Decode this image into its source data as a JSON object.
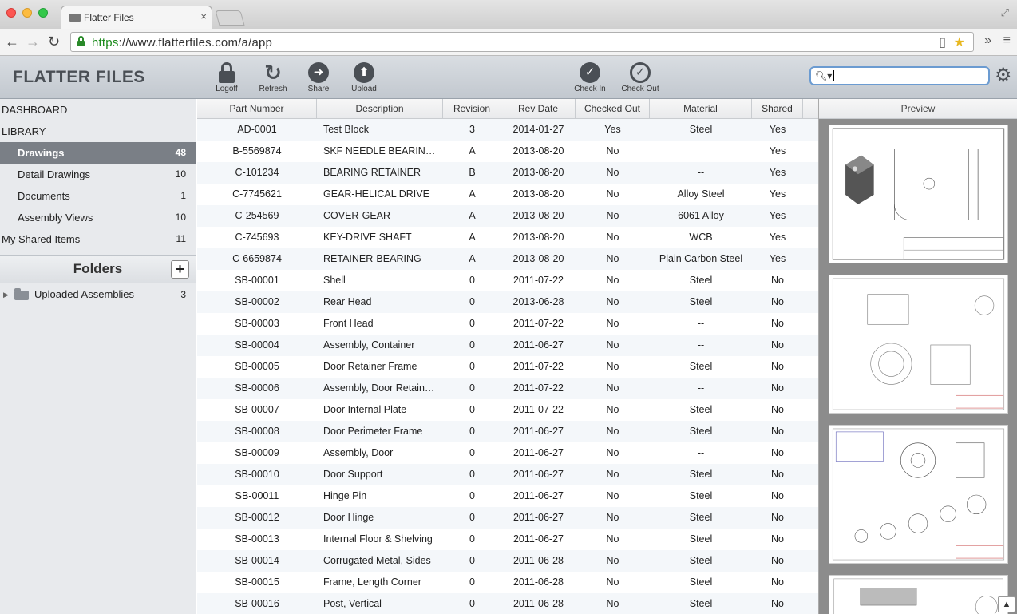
{
  "browser": {
    "tab_title": "Flatter Files",
    "tab_close": "×",
    "url_scheme": "https",
    "url_rest": "://www.flatterfiles.com/a/app"
  },
  "app": {
    "logo": "FLATTER FILES",
    "toolbar": {
      "logoff": "Logoff",
      "refresh": "Refresh",
      "share": "Share",
      "upload": "Upload",
      "checkin": "Check In",
      "checkout": "Check Out"
    },
    "search": {
      "value": "",
      "placeholder": ""
    }
  },
  "sidebar": {
    "dashboard": "DASHBOARD",
    "library": "LIBRARY",
    "items": [
      {
        "label": "Drawings",
        "count": "48"
      },
      {
        "label": "Detail Drawings",
        "count": "10"
      },
      {
        "label": "Documents",
        "count": "1"
      },
      {
        "label": "Assembly Views",
        "count": "10"
      }
    ],
    "shared": {
      "label": "My Shared Items",
      "count": "11"
    },
    "folders_title": "Folders",
    "folders_add": "+",
    "folders": [
      {
        "label": "Uploaded Assemblies",
        "count": "3"
      }
    ]
  },
  "table": {
    "columns": [
      "Part Number",
      "Description",
      "Revision",
      "Rev Date",
      "Checked Out",
      "Material",
      "Shared"
    ],
    "rows": [
      [
        "AD-0001",
        "Test Block",
        "3",
        "2014-01-27",
        "Yes",
        "Steel",
        "Yes"
      ],
      [
        "B-5569874",
        "SKF NEEDLE BEARING ...",
        "A",
        "2013-08-20",
        "No",
        "",
        "Yes"
      ],
      [
        "C-101234",
        "BEARING RETAINER",
        "B",
        "2013-08-20",
        "No",
        "--",
        "Yes"
      ],
      [
        "C-7745621",
        "GEAR-HELICAL DRIVE",
        "A",
        "2013-08-20",
        "No",
        "Alloy Steel",
        "Yes"
      ],
      [
        "C-254569",
        "COVER-GEAR",
        "A",
        "2013-08-20",
        "No",
        "6061 Alloy",
        "Yes"
      ],
      [
        "C-745693",
        "KEY-DRIVE SHAFT",
        "A",
        "2013-08-20",
        "No",
        "WCB",
        "Yes"
      ],
      [
        "C-6659874",
        "RETAINER-BEARING",
        "A",
        "2013-08-20",
        "No",
        "Plain Carbon Steel",
        "Yes"
      ],
      [
        "SB-00001",
        "Shell",
        "0",
        "2011-07-22",
        "No",
        "Steel",
        "No"
      ],
      [
        "SB-00002",
        "Rear Head",
        "0",
        "2013-06-28",
        "No",
        "Steel",
        "No"
      ],
      [
        "SB-00003",
        "Front Head",
        "0",
        "2011-07-22",
        "No",
        "--",
        "No"
      ],
      [
        "SB-00004",
        "Assembly, Container",
        "0",
        "2011-06-27",
        "No",
        "--",
        "No"
      ],
      [
        "SB-00005",
        "Door Retainer Frame",
        "0",
        "2011-07-22",
        "No",
        "Steel",
        "No"
      ],
      [
        "SB-00006",
        "Assembly, Door Retainer...",
        "0",
        "2011-07-22",
        "No",
        "--",
        "No"
      ],
      [
        "SB-00007",
        "Door Internal Plate",
        "0",
        "2011-07-22",
        "No",
        "Steel",
        "No"
      ],
      [
        "SB-00008",
        "Door Perimeter Frame",
        "0",
        "2011-06-27",
        "No",
        "Steel",
        "No"
      ],
      [
        "SB-00009",
        "Assembly, Door",
        "0",
        "2011-06-27",
        "No",
        "--",
        "No"
      ],
      [
        "SB-00010",
        "Door Support",
        "0",
        "2011-06-27",
        "No",
        "Steel",
        "No"
      ],
      [
        "SB-00011",
        "Hinge Pin",
        "0",
        "2011-06-27",
        "No",
        "Steel",
        "No"
      ],
      [
        "SB-00012",
        "Door Hinge",
        "0",
        "2011-06-27",
        "No",
        "Steel",
        "No"
      ],
      [
        "SB-00013",
        "Internal Floor & Shelving",
        "0",
        "2011-06-27",
        "No",
        "Steel",
        "No"
      ],
      [
        "SB-00014",
        "Corrugated Metal, Sides",
        "0",
        "2011-06-28",
        "No",
        "Steel",
        "No"
      ],
      [
        "SB-00015",
        "Frame, Length Corner",
        "0",
        "2011-06-28",
        "No",
        "Steel",
        "No"
      ],
      [
        "SB-00016",
        "Post, Vertical",
        "0",
        "2011-06-28",
        "No",
        "Steel",
        "No"
      ]
    ]
  },
  "preview": {
    "title": "Preview",
    "scroll_up": "▲"
  },
  "colors": {
    "accent": "#6b9bd1",
    "sidebar_active": "#7a7f86",
    "header": "#c2c8cf"
  }
}
